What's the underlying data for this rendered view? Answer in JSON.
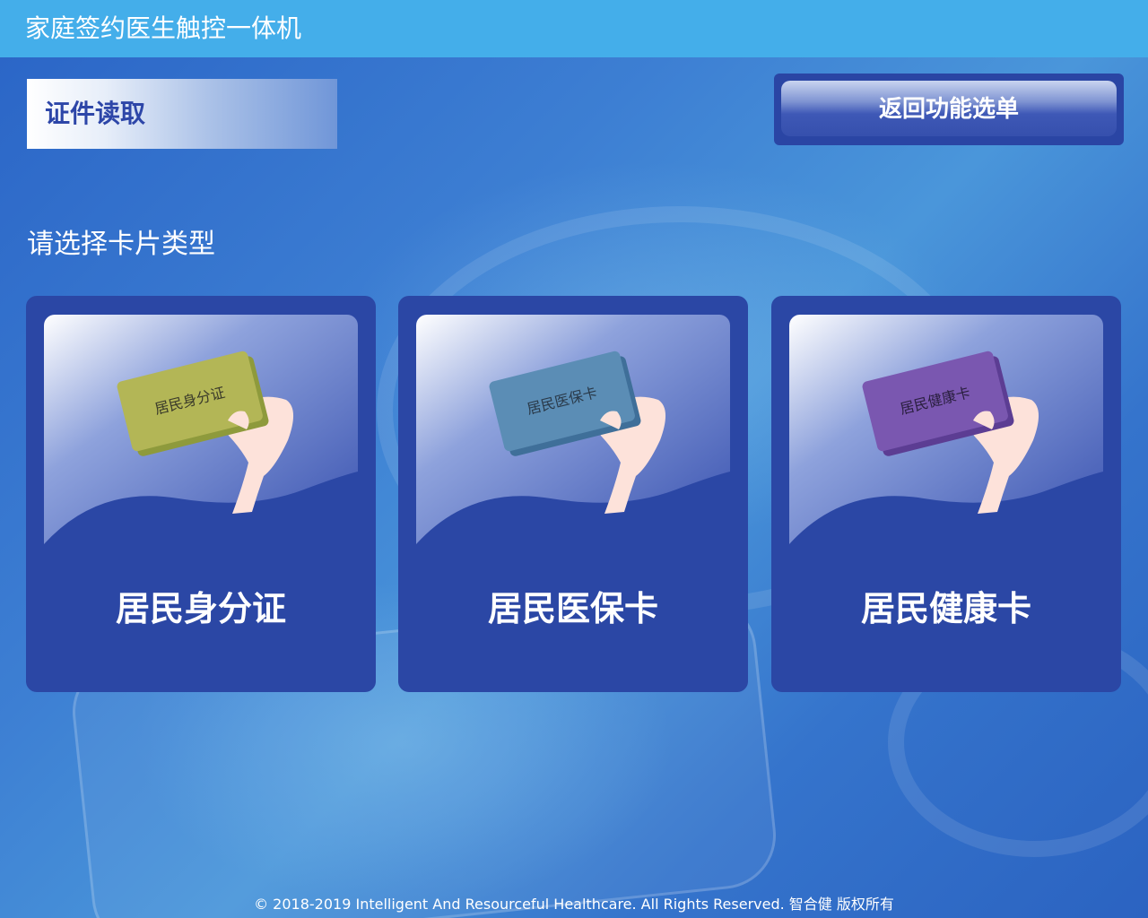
{
  "app": {
    "title": "家庭签约医生触控一体机"
  },
  "section": {
    "label": "证件读取"
  },
  "back_button": {
    "label": "返回功能选单"
  },
  "prompt": "请选择卡片类型",
  "cards": [
    {
      "title": "居民身分证",
      "card_text": "居民身分证",
      "card_color": "#b3b656",
      "card_edge": "#8e9a3c"
    },
    {
      "title": "居民医保卡",
      "card_text": "居民医保卡",
      "card_color": "#5b8db5",
      "card_edge": "#3f6f99"
    },
    {
      "title": "居民健康卡",
      "card_text": "居民健康卡",
      "card_color": "#7a57b0",
      "card_edge": "#5c3d93"
    }
  ],
  "footer": "© 2018-2019 Intelligent And Resourceful Healthcare. All Rights Reserved. 智合健 版权所有",
  "colors": {
    "topbar": "#44aeea",
    "card_bg": "#2b47a5",
    "hand": "#fde2da"
  }
}
